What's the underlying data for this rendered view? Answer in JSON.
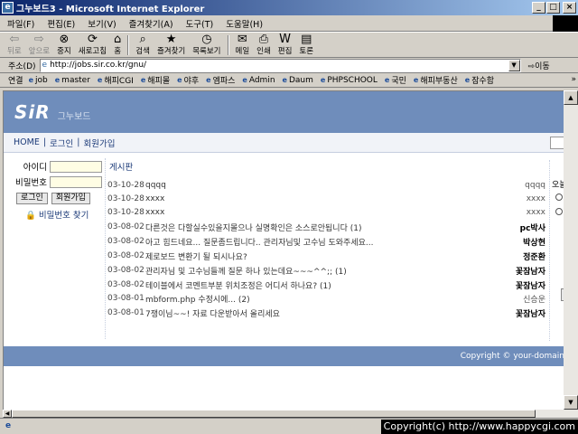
{
  "window": {
    "title": "그누보드3 - Microsoft Internet Explorer",
    "minimize": "_",
    "maximize": "□",
    "close": "×"
  },
  "menu": [
    "파일(F)",
    "편집(E)",
    "보기(V)",
    "즐겨찾기(A)",
    "도구(T)",
    "도움말(H)"
  ],
  "toolbar": {
    "back": "뒤로",
    "forward": "앞으로",
    "stop": "중지",
    "refresh": "새로고침",
    "home": "홈",
    "search": "검색",
    "favorites": "즐겨찾기",
    "history": "목록보기",
    "mail": "메일",
    "print": "인쇄",
    "edit": "편집",
    "discuss": "토론"
  },
  "address": {
    "label": "주소(D)",
    "url": "http://jobs.sir.co.kr/gnu/",
    "go": "이동"
  },
  "links": {
    "label": "연결",
    "items": [
      "job",
      "master",
      "해피CGI",
      "해피몰",
      "야후",
      "엠파스",
      "Admin",
      "Daum",
      "PHPSCHOOL",
      "국민",
      "해피부동산",
      "잠수함"
    ]
  },
  "page": {
    "logo": "SiR",
    "logo_sub": "그누보드",
    "nav": [
      "HOME",
      "로그인",
      "회원가입"
    ],
    "login": {
      "id_label": "아이디",
      "pw_label": "비밀번호",
      "login_btn": "로그인",
      "join_btn": "회원가입",
      "find_pw": "비밀번호 찾기"
    },
    "board_title": "게시판",
    "posts": [
      {
        "date": "03-10-28",
        "subject": "qqqq",
        "author": "qqqq",
        "bold": false
      },
      {
        "date": "03-10-28",
        "subject": "xxxx",
        "author": "xxxx",
        "bold": false
      },
      {
        "date": "03-10-28",
        "subject": "xxxx",
        "author": "xxxx",
        "bold": false
      },
      {
        "date": "03-08-02",
        "subject": "다른것은 다할실수있을지몰으나 실명확인은 소스로안됩니다 (1)",
        "author": "pc박사",
        "bold": true
      },
      {
        "date": "03-08-02",
        "subject": "아고 힘드네요... 질문좀드립니다.. 관리자님및 고수님 도와주세요...",
        "author": "박상현",
        "bold": true
      },
      {
        "date": "03-08-02",
        "subject": "제로보드 변환기 될 되시나요?",
        "author": "정준환",
        "bold": true
      },
      {
        "date": "03-08-02",
        "subject": "관리자님 및 고수님들께 질문 하나 있는데요~~~^^;; (1)",
        "author": "꽃잠남자",
        "bold": true
      },
      {
        "date": "03-08-02",
        "subject": "테이블에서 코멘트부분 위치조정은 어디서 하나요? (1)",
        "author": "꽃잠남자",
        "bold": true
      },
      {
        "date": "03-08-01",
        "subject": "mbform.php 수정시에... (2)",
        "author": "신승운",
        "bold": false
      },
      {
        "date": "03-08-01",
        "subject": "7쟁이님~~! 자료 다운받아서 올리세요",
        "author": "꽃잠남자",
        "bold": true
      }
    ],
    "poll_label": "오늘",
    "footer": "Copyright © your-domain"
  },
  "status": {
    "text": "Copyright(c) http://www.happycgi.com"
  }
}
